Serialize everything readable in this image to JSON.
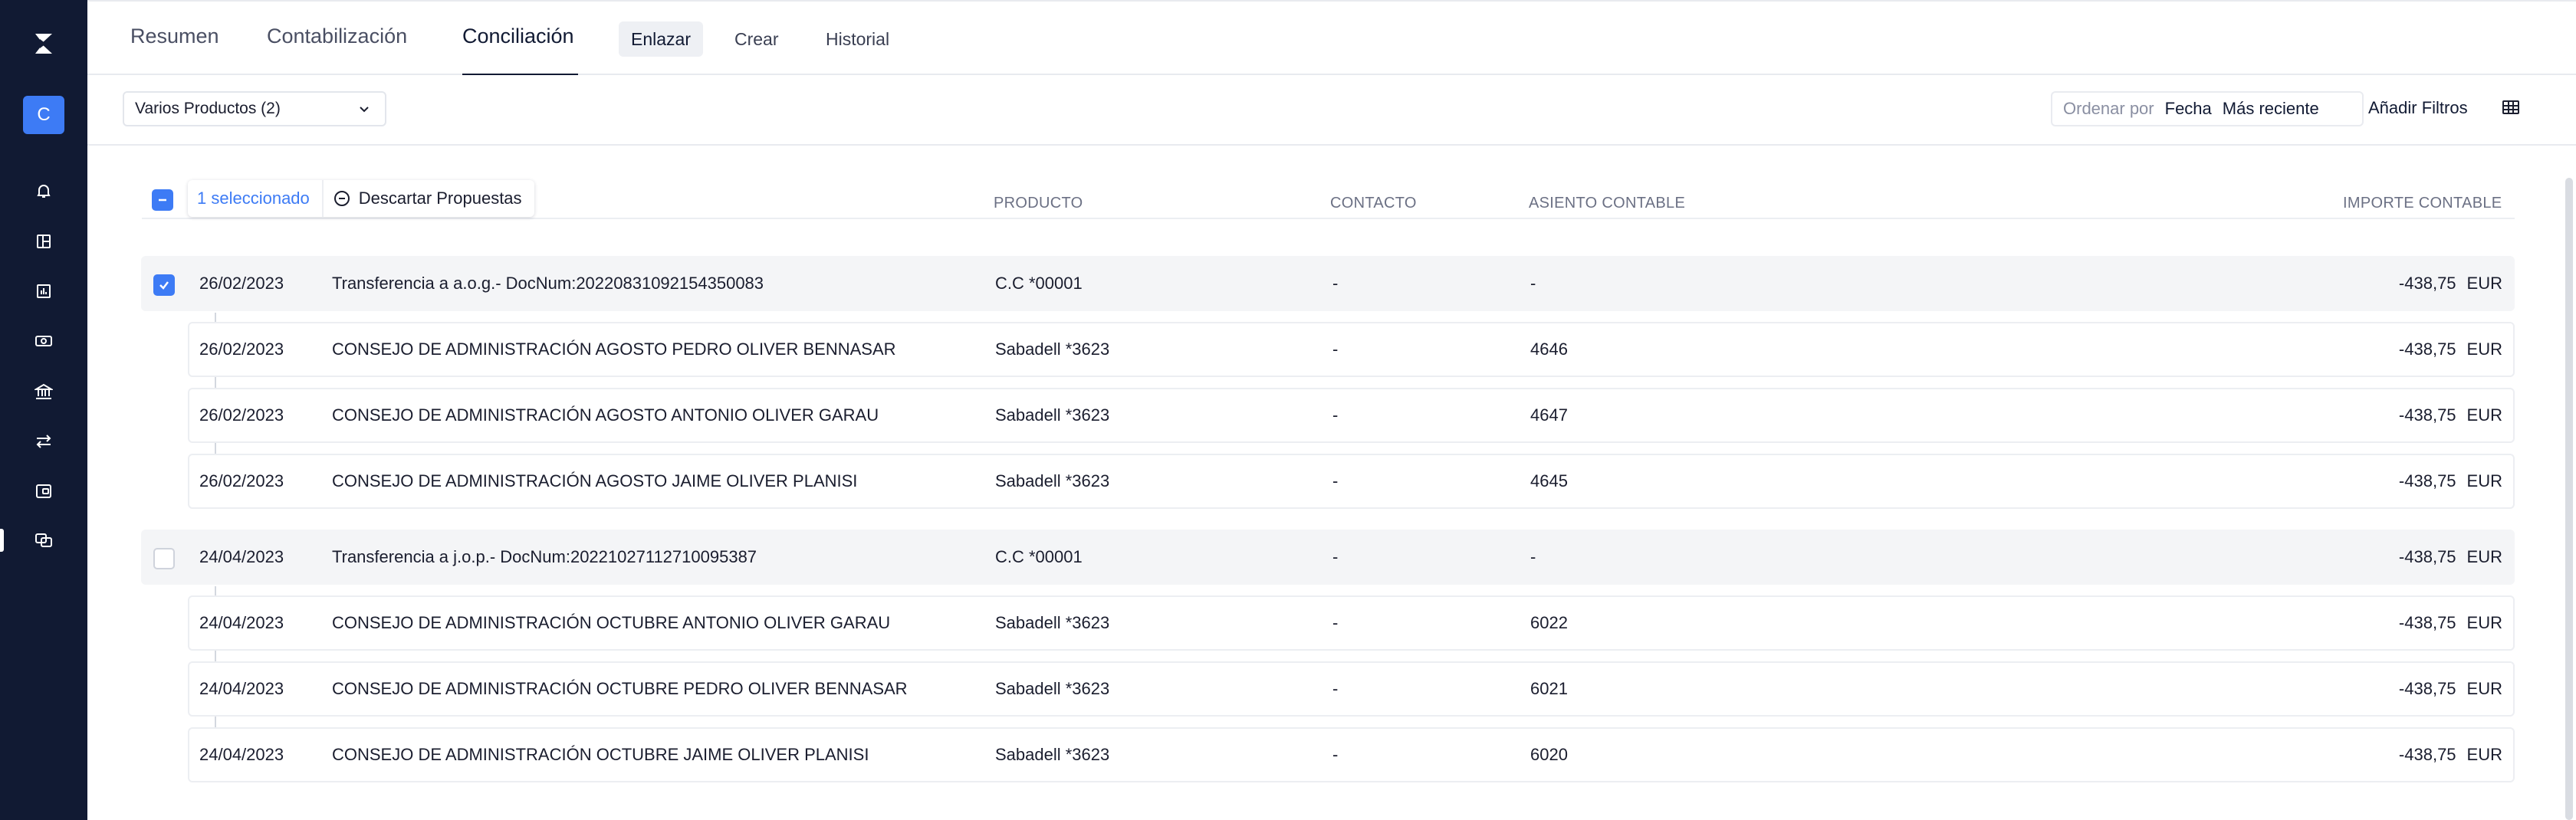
{
  "sidebar": {
    "company_initial": "C",
    "nav": [
      "bell-icon",
      "dashboard-icon",
      "report-icon",
      "cash-icon",
      "bank-icon",
      "transfer-icon",
      "wallet-icon",
      "reconcile-icon"
    ]
  },
  "tabs": {
    "main": [
      "Resumen",
      "Contabilización",
      "Conciliación"
    ],
    "sub": [
      "Enlazar",
      "Crear",
      "Historial"
    ]
  },
  "filters": {
    "product_select": "Varios Productos (2)",
    "sort_label": "Ordenar por",
    "sort_field": "Fecha",
    "sort_order": "Más reciente",
    "add_filters": "Añadir Filtros"
  },
  "selection": {
    "count_label": "1 seleccionado",
    "discard_label": "Descartar Propuestas"
  },
  "columns": {
    "product": "PRODUCTO",
    "contact": "CONTACTO",
    "entry": "ASIENTO CONTABLE",
    "amount": "IMPORTE CONTABLE"
  },
  "rows": [
    {
      "date": "26/02/2023",
      "description": "Transferencia a a.o.g.- DocNum:20220831092154350083",
      "product": "C.C *00001",
      "contact": "-",
      "entry": "-",
      "amount": "-438,75",
      "currency": "EUR"
    },
    {
      "date": "26/02/2023",
      "description": "CONSEJO DE ADMINISTRACIÓN AGOSTO PEDRO OLIVER BENNASAR",
      "product": "Sabadell *3623",
      "contact": "-",
      "entry": "4646",
      "amount": "-438,75",
      "currency": "EUR"
    },
    {
      "date": "26/02/2023",
      "description": "CONSEJO DE ADMINISTRACIÓN AGOSTO ANTONIO OLIVER GARAU",
      "product": "Sabadell *3623",
      "contact": "-",
      "entry": "4647",
      "amount": "-438,75",
      "currency": "EUR"
    },
    {
      "date": "26/02/2023",
      "description": "CONSEJO DE ADMINISTRACIÓN AGOSTO JAIME OLIVER PLANISI",
      "product": "Sabadell *3623",
      "contact": "-",
      "entry": "4645",
      "amount": "-438,75",
      "currency": "EUR"
    },
    {
      "date": "24/04/2023",
      "description": "Transferencia a j.o.p.- DocNum:20221027112710095387",
      "product": "C.C *00001",
      "contact": "-",
      "entry": "-",
      "amount": "-438,75",
      "currency": "EUR"
    },
    {
      "date": "24/04/2023",
      "description": "CONSEJO DE ADMINISTRACIÓN OCTUBRE ANTONIO OLIVER GARAU",
      "product": "Sabadell *3623",
      "contact": "-",
      "entry": "6022",
      "amount": "-438,75",
      "currency": "EUR"
    },
    {
      "date": "24/04/2023",
      "description": "CONSEJO DE ADMINISTRACIÓN OCTUBRE PEDRO OLIVER BENNASAR",
      "product": "Sabadell *3623",
      "contact": "-",
      "entry": "6021",
      "amount": "-438,75",
      "currency": "EUR"
    },
    {
      "date": "24/04/2023",
      "description": "CONSEJO DE ADMINISTRACIÓN OCTUBRE JAIME OLIVER PLANISI",
      "product": "Sabadell *3623",
      "contact": "-",
      "entry": "6020",
      "amount": "-438,75",
      "currency": "EUR"
    }
  ],
  "colors": {
    "accent": "#3d7bf5",
    "sidebar": "#111a33"
  }
}
